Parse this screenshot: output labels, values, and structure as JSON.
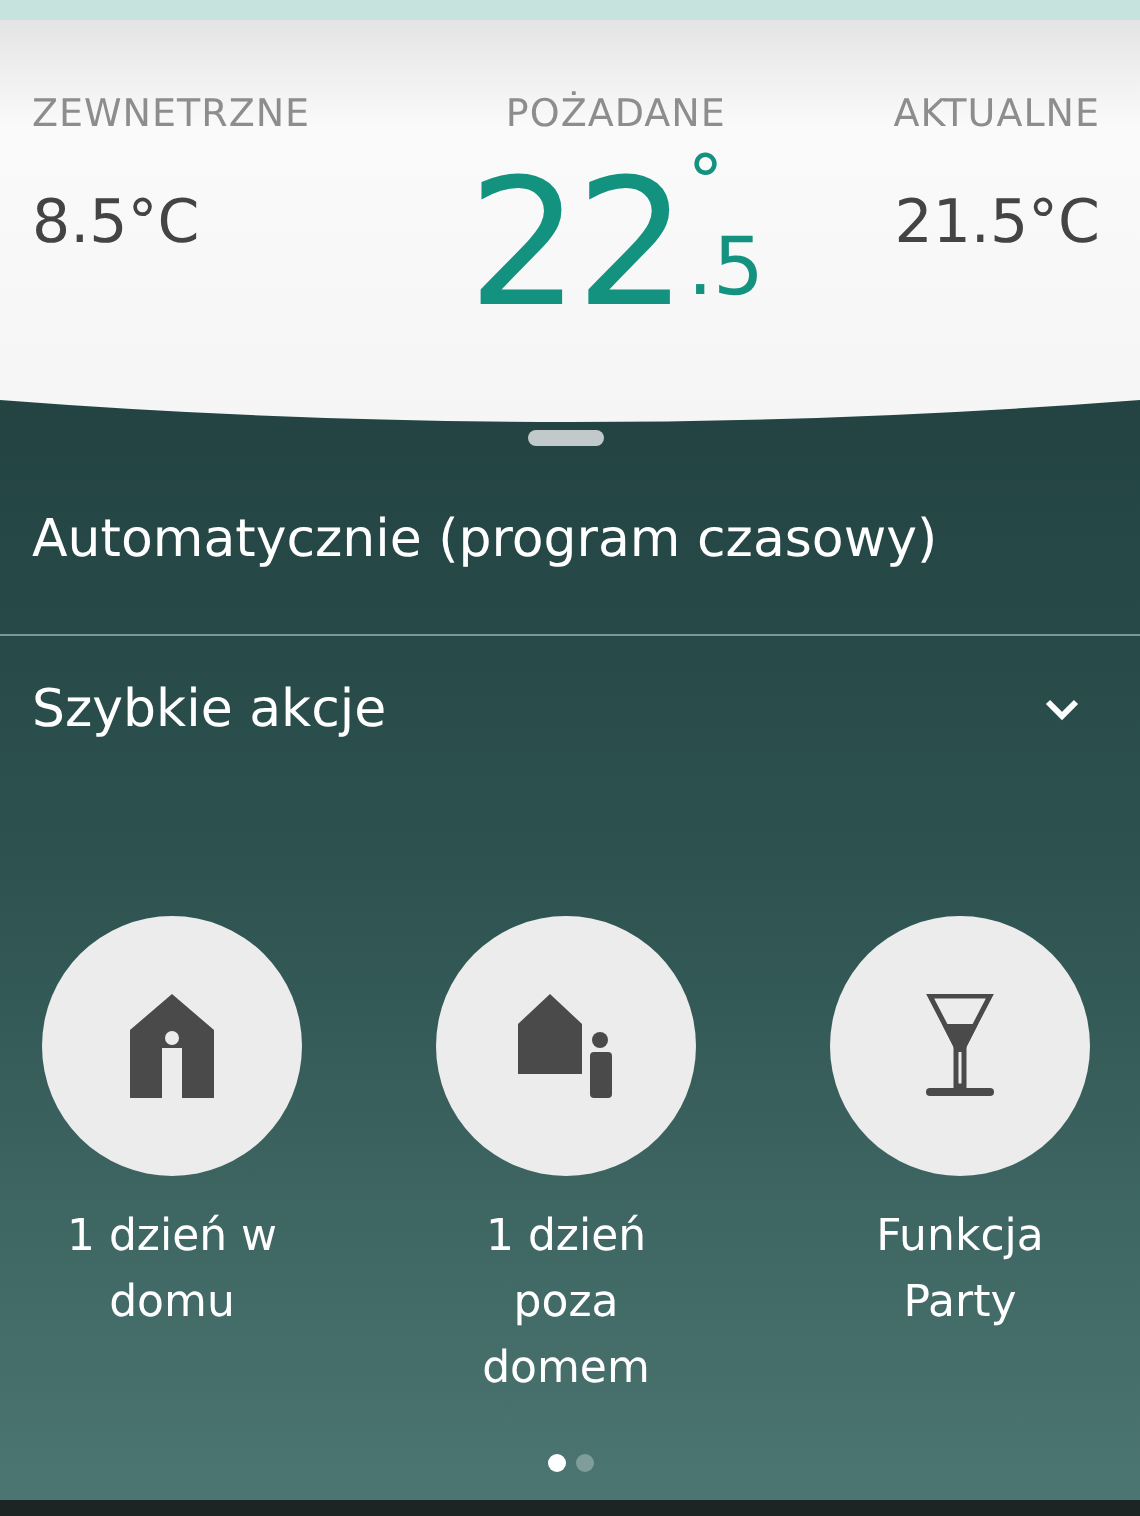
{
  "readings": [
    {
      "label": "ZEWNETRZNE",
      "value": "8.5°C"
    },
    {
      "label": "AKTUALNE",
      "value": "21.5°C"
    }
  ],
  "desired": {
    "label": "POŻADANE",
    "whole": "22",
    "degree": "°",
    "fraction": ".5"
  },
  "mode": "Automatycznie (program czasowy)",
  "quick_actions": {
    "title": "Szybkie akcje",
    "items": [
      {
        "kind": "home",
        "label": "1 dzień w domu"
      },
      {
        "kind": "away",
        "label": "1 dzień poza domem"
      },
      {
        "kind": "party",
        "label": "Funkcja Party"
      }
    ]
  },
  "pages": [
    {
      "selected": true
    },
    {
      "selected": false
    }
  ]
}
